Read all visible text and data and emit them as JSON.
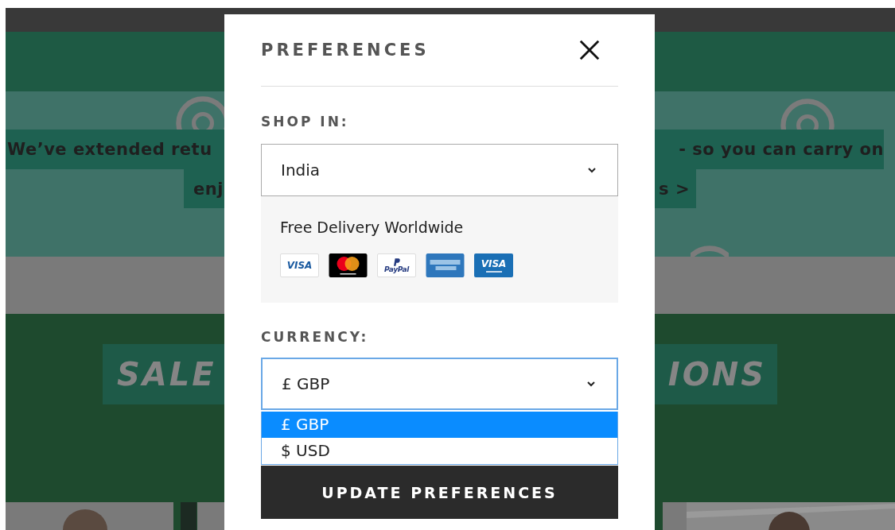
{
  "banner": {
    "line_1_start": "We’ve extended retu",
    "line_1_end": "- so you can carry on",
    "line_2_start": "enj",
    "line_2_end": "s >"
  },
  "sale_heading": {
    "start": "SALE",
    "end": "IONS"
  },
  "modal": {
    "title": "PREFERENCES",
    "shop_in": {
      "label": "SHOP IN:",
      "value": "India"
    },
    "delivery_note": "Free Delivery Worldwide",
    "payment_methods": [
      {
        "kind": "visa",
        "label": "VISA"
      },
      {
        "kind": "mastercard"
      },
      {
        "kind": "paypal",
        "label": "PayPal"
      },
      {
        "kind": "amex"
      },
      {
        "kind": "visa_electron",
        "label": "VISA"
      }
    ],
    "currency": {
      "label": "CURRENCY:",
      "value": "£ GBP",
      "expanded": true,
      "options": [
        {
          "label": "£ GBP",
          "selected": true
        },
        {
          "label": "$ USD",
          "selected": false
        }
      ]
    },
    "button": "UPDATE PREFERENCES"
  }
}
